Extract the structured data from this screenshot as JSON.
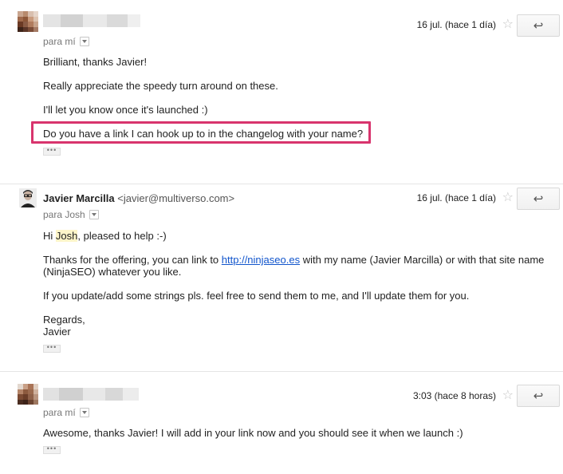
{
  "messages": [
    {
      "recipient": "para mí",
      "date": "16 jul. (hace 1 día)",
      "lines": [
        "Brilliant, thanks Javier!",
        "Really appreciate the speedy turn around on these.",
        "I'll let you know once it's launched :)",
        "Do you have a link I can hook up to in the changelog with your name?"
      ]
    },
    {
      "sender_name": "Javier Marcilla",
      "sender_email": "<javier@multiverso.com>",
      "recipient": "para Josh",
      "date": "16 jul. (hace 1 día)",
      "greeting_prefix": "Hi ",
      "greeting_name": "Josh",
      "greeting_suffix": ", pleased to help :-)",
      "para1_prefix": "Thanks for the offering, you can link to ",
      "para1_link": "http://ninjaseo.es",
      "para1_suffix": " with my name (Javier Marcilla) or with that site name",
      "para1_line2": "(NinjaSEO) whatever you like.",
      "para2": "If you update/add some strings pls. feel free to send them to me, and I'll update them for you.",
      "sign1": "Regards,",
      "sign2": "Javier"
    },
    {
      "recipient": "para mí",
      "date": "3:03 (hace 8 horas)",
      "lines": [
        "Awesome, thanks Javier! I will add in your link now and you should see it when we launch :)"
      ]
    }
  ],
  "icons": {
    "star": "☆",
    "reply": "↩",
    "ellipsis": "•••"
  },
  "colors": {
    "highlight_border": "#d8346d",
    "link": "#1155cc"
  }
}
